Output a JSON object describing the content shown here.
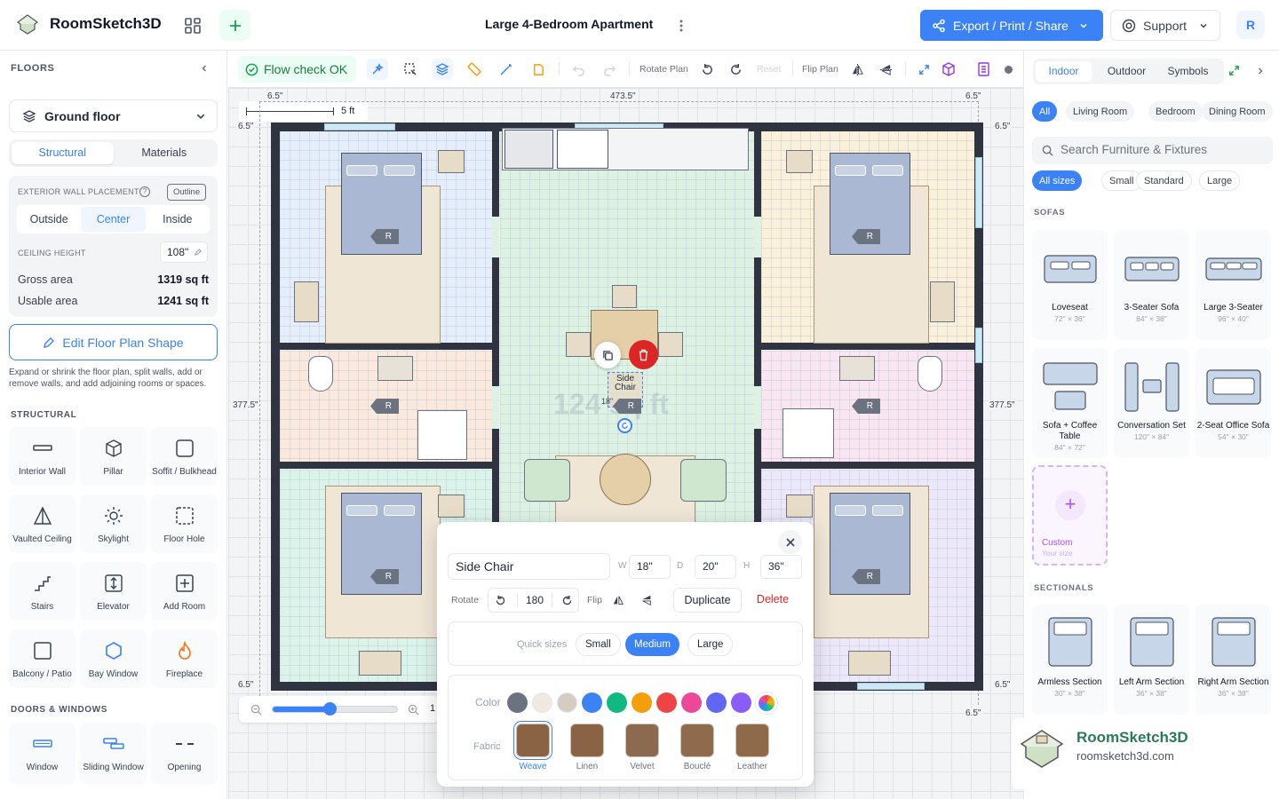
{
  "app": {
    "name": "RoomSketch3D",
    "plan_title": "Large 4-Bedroom Apartment",
    "export_label": "Export / Print / Share",
    "support_label": "Support",
    "avatar_initial": "R",
    "accent": "#3b82f6"
  },
  "sidebar": {
    "floors_label": "FLOORS",
    "floor_selected": "Ground floor",
    "tabs": [
      "Structural",
      "Materials"
    ],
    "wall_placement_label": "EXTERIOR WALL PLACEMENT",
    "outline_badge": "Outline",
    "placement_options": [
      "Outside",
      "Center",
      "Inside"
    ],
    "ceiling_label": "CEILING HEIGHT",
    "ceiling_value": "108\"",
    "gross_label": "Gross area",
    "gross_value": "1319 sq ft",
    "usable_label": "Usable area",
    "usable_value": "1241 sq ft",
    "edit_label": "Edit Floor Plan Shape",
    "edit_help": "Expand or shrink the floor plan, split walls, add or remove walls, and add adjoining rooms or spaces.",
    "structural_label": "STRUCTURAL",
    "structural_items": [
      "Interior Wall",
      "Pillar",
      "Soffit / Bulkhead",
      "Vaulted Ceiling",
      "Skylight",
      "Floor Hole",
      "Stairs",
      "Elevator",
      "Add Room",
      "Balcony / Patio",
      "Bay Window",
      "Fireplace"
    ],
    "doors_label": "DOORS & WINDOWS",
    "door_items": [
      "Window",
      "Sliding Window",
      "Opening"
    ]
  },
  "toolbar": {
    "flow_check": "Flow check OK",
    "rotate_plan": "Rotate Plan",
    "reset": "Reset",
    "flip_plan": "Flip Plan"
  },
  "canvas": {
    "scale_label": "5 ft",
    "dims": {
      "top_total": "473.5\"",
      "top_left_offset": "6.5\"",
      "top_right_offset": "6.5\"",
      "left_height": "377.5\"",
      "right_height": "377.5\"",
      "corner": "6.5\""
    },
    "room_badge": "R",
    "area_label": "124 sq ft",
    "selected_label": "Side Chair",
    "selected_dim": "18\""
  },
  "popup": {
    "name": "Side Chair",
    "w_label": "W",
    "w": "18\"",
    "d_label": "D",
    "d": "20\"",
    "h_label": "H",
    "h": "36\"",
    "rotate_label": "Rotate",
    "rotate_value": "180",
    "flip_label": "Flip",
    "duplicate": "Duplicate",
    "delete": "Delete",
    "quick_label": "Quick sizes",
    "sizes": [
      "Small",
      "Medium",
      "Large"
    ],
    "color_label": "Color",
    "fabric_label": "Fabric",
    "colors": [
      "#6b7280",
      "#efe9df",
      "#d6cdc2",
      "#3b82f6",
      "#10b981",
      "#f59e0b",
      "#ef4444",
      "#ec4899",
      "#6366f1",
      "#8b5cf6"
    ],
    "fabrics": [
      "Weave",
      "Linen",
      "Velvet",
      "Bouclé",
      "Leather"
    ]
  },
  "zoom": {
    "value_fraction": 0.46,
    "value_text": "1"
  },
  "right": {
    "tabs": [
      "Indoor",
      "Outdoor",
      "Symbols"
    ],
    "categories": [
      "All",
      "Living Room",
      "Bedroom",
      "Dining Room"
    ],
    "search_placeholder": "Search Furniture & Fixtures",
    "sizes": [
      "All sizes",
      "Small",
      "Standard",
      "Large"
    ],
    "sofas_label": "SOFAS",
    "sofas": [
      {
        "name": "Loveseat",
        "size": "72\" × 36\""
      },
      {
        "name": "3-Seater Sofa",
        "size": "84\" × 38\""
      },
      {
        "name": "Large 3-Seater",
        "size": "96\" × 40\""
      },
      {
        "name": "Sofa + Coffee Table",
        "size": "84\" × 72\""
      },
      {
        "name": "Conversation Set",
        "size": "120\" × 84\""
      },
      {
        "name": "2-Seat Office Sofa",
        "size": "54\" × 30\""
      }
    ],
    "custom_label": "Custom",
    "custom_sub": "Your size",
    "sectionals_label": "SECTIONALS",
    "sectionals": [
      {
        "name": "Armless Section",
        "size": "30\" × 38\""
      },
      {
        "name": "Left Arm Section",
        "size": "36\" × 38\""
      },
      {
        "name": "Right Arm Section",
        "size": "36\" × 38\""
      }
    ]
  },
  "watermark": {
    "name": "RoomSketch3D",
    "url": "roomsketch3d.com"
  }
}
